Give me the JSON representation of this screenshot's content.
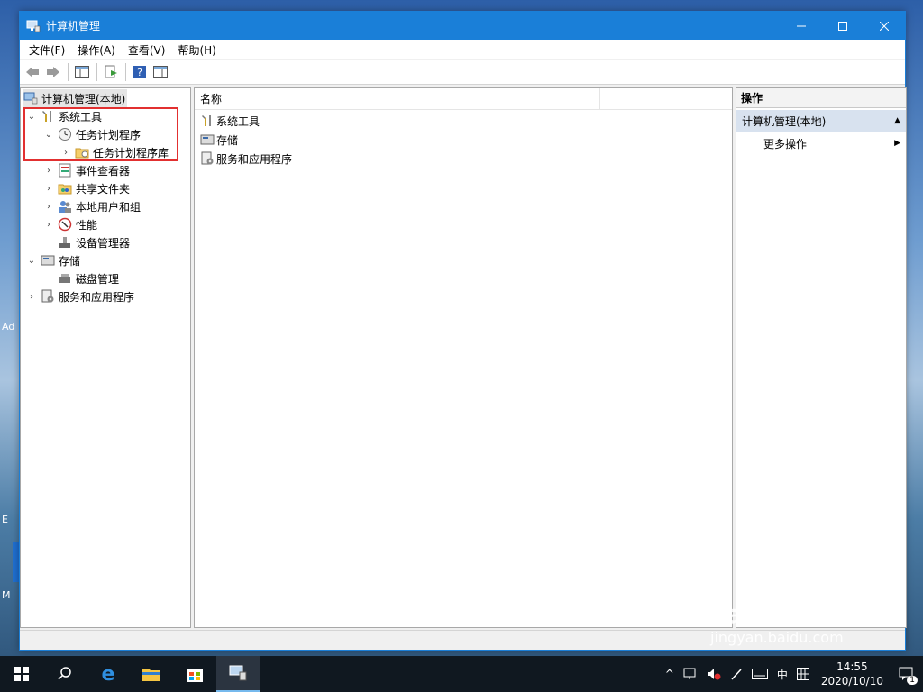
{
  "window": {
    "title": "计算机管理"
  },
  "menu": [
    {
      "label": "文件(F)"
    },
    {
      "label": "操作(A)"
    },
    {
      "label": "查看(V)"
    },
    {
      "label": "帮助(H)"
    }
  ],
  "tree": {
    "root": "计算机管理(本地)",
    "items": [
      {
        "label": "系统工具"
      },
      {
        "label": "任务计划程序"
      },
      {
        "label": "任务计划程序库"
      },
      {
        "label": "事件查看器"
      },
      {
        "label": "共享文件夹"
      },
      {
        "label": "本地用户和组"
      },
      {
        "label": "性能"
      },
      {
        "label": "设备管理器"
      },
      {
        "label": "存储"
      },
      {
        "label": "磁盘管理"
      },
      {
        "label": "服务和应用程序"
      }
    ]
  },
  "list": {
    "header": "名称",
    "items": [
      {
        "label": "系统工具"
      },
      {
        "label": "存储"
      },
      {
        "label": "服务和应用程序"
      }
    ]
  },
  "actions": {
    "header": "操作",
    "section": "计算机管理(本地)",
    "more": "更多操作"
  },
  "taskbar": {
    "ime": "中",
    "time": "14:55",
    "date": "2020/10/10",
    "notification_count": "1"
  },
  "watermark": {
    "brand": "Bai du 经验",
    "url": "jingyan.baidu.com"
  },
  "desktop": {
    "snippets": [
      "Ad",
      "E",
      "M"
    ]
  },
  "colors": {
    "titlebar": "#1a7fd8",
    "highlight": "#e23030",
    "taskbar": "#101820"
  }
}
